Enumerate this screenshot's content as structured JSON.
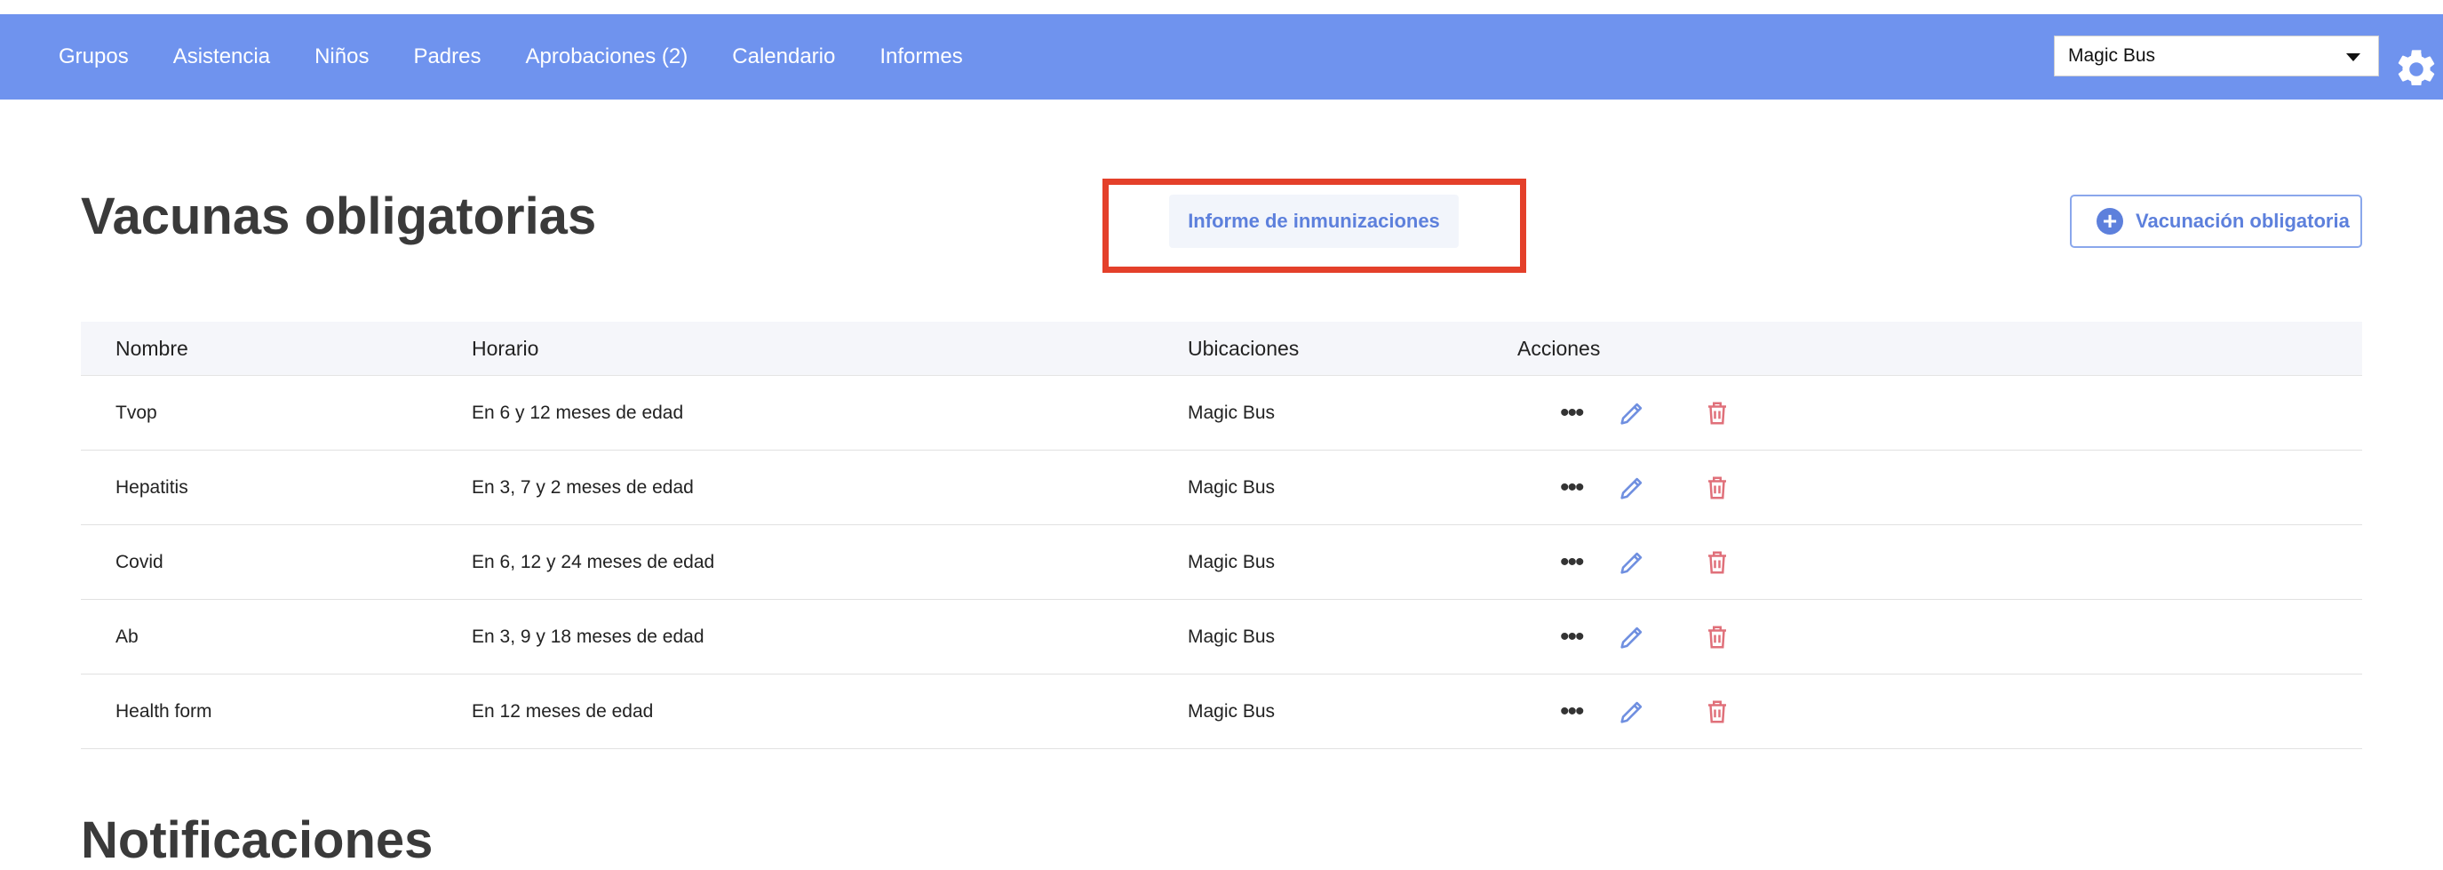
{
  "nav": {
    "items": [
      {
        "label": "Grupos"
      },
      {
        "label": "Asistencia"
      },
      {
        "label": "Niños"
      },
      {
        "label": "Padres"
      },
      {
        "label": "Aprobaciones (2)"
      },
      {
        "label": "Calendario"
      },
      {
        "label": "Informes"
      }
    ]
  },
  "org_select": {
    "value": "Magic Bus"
  },
  "settings": {
    "icon": "gear-icon"
  },
  "page": {
    "title": "Vacunas obligatorias",
    "report_button": "Informe de inmunizaciones",
    "add_button": "Vacunación obligatoria",
    "next_section_title": "Notificaciones"
  },
  "table": {
    "headers": {
      "name": "Nombre",
      "schedule": "Horario",
      "locations": "Ubicaciones",
      "actions": "Acciones"
    },
    "rows": [
      {
        "name": "Tvop",
        "schedule": "En 6 y 12 meses de edad",
        "location": "Magic Bus"
      },
      {
        "name": "Hepatitis",
        "schedule": "En 3, 7 y 2 meses de edad",
        "location": "Magic Bus"
      },
      {
        "name": "Covid",
        "schedule": "En 6, 12 y 24 meses de edad",
        "location": "Magic Bus"
      },
      {
        "name": "Ab",
        "schedule": "En 3, 9 y 18 meses de edad",
        "location": "Magic Bus"
      },
      {
        "name": "Health form",
        "schedule": "En 12 meses de edad",
        "location": "Magic Bus"
      }
    ],
    "action_icons": [
      "more-icon",
      "pencil-icon",
      "trash-icon"
    ]
  },
  "colors": {
    "nav_bg": "#6f93ee",
    "accent": "#5d80dc",
    "highlight": "#e4402a",
    "delete": "#e0707a"
  }
}
